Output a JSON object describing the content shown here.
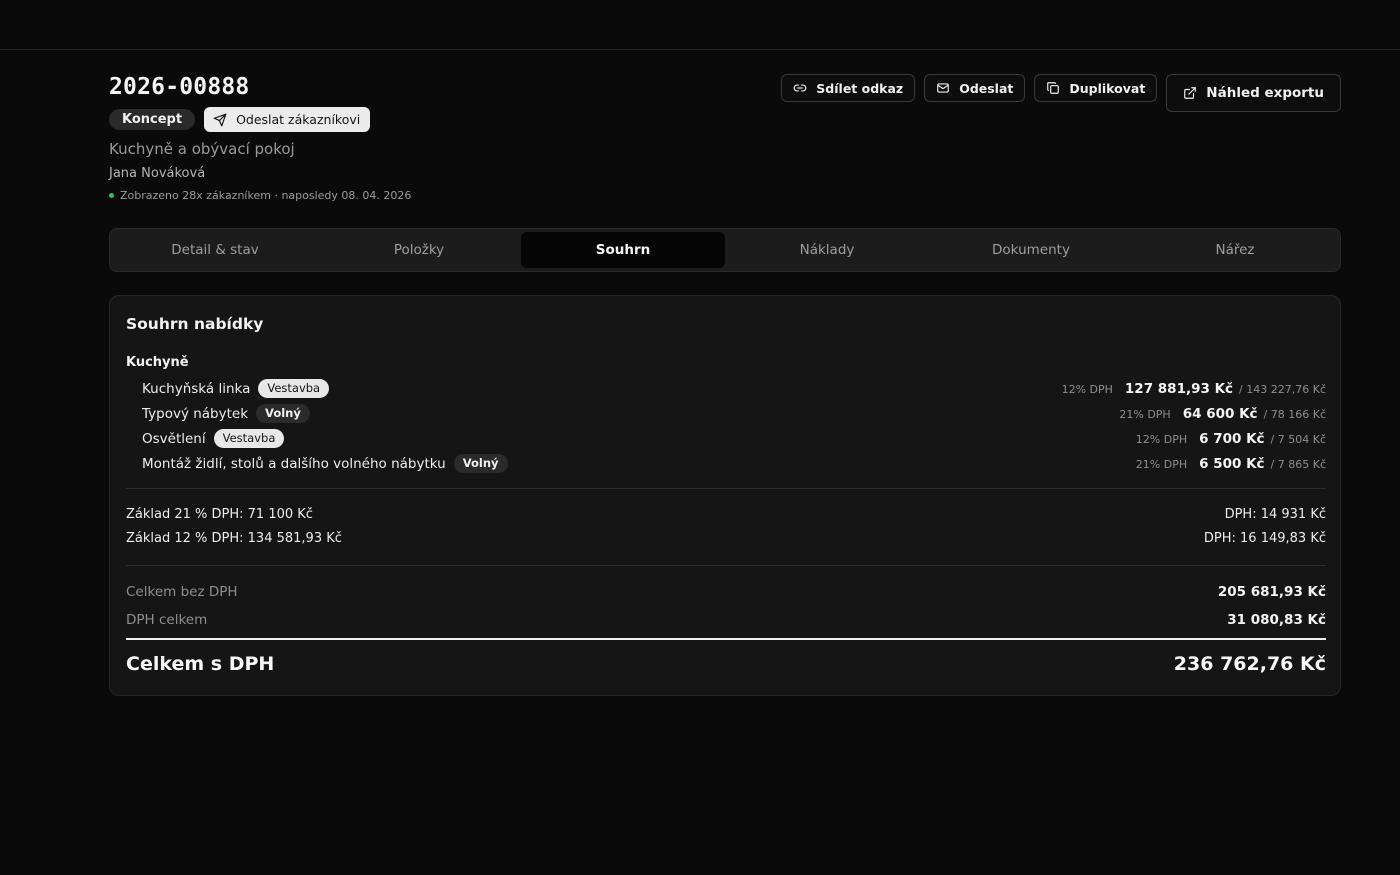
{
  "header": {
    "doc_id": "2026-00888",
    "status": "Koncept",
    "send_to_customer_label": "Odeslat zákazníkovi",
    "subtitle": "Kuchyně a obývací pokoj",
    "customer": "Jana Nováková",
    "viewed": "Zobrazeno 28x zákazníkem · naposledy 08. 04. 2026"
  },
  "actions": {
    "share_label": "Sdílet odkaz",
    "send_label": "Odeslat",
    "duplicate_label": "Duplikovat",
    "preview_label": "Náhled exportu"
  },
  "tabs": [
    {
      "label": "Detail & stav",
      "active": false
    },
    {
      "label": "Položky",
      "active": false
    },
    {
      "label": "Souhrn",
      "active": true
    },
    {
      "label": "Náklady",
      "active": false
    },
    {
      "label": "Dokumenty",
      "active": false
    },
    {
      "label": "Nářez",
      "active": false
    }
  ],
  "summary": {
    "title": "Souhrn nabídky",
    "group": "Kuchyně",
    "items": [
      {
        "name": "Kuchyňská linka",
        "tag": "Vestavba",
        "tag_style": "light",
        "vat": "12% DPH",
        "net": "127 881,93 Kč",
        "gross": "/ 143 227,76 Kč"
      },
      {
        "name": "Typový nábytek",
        "tag": "Volný",
        "tag_style": "dark",
        "vat": "21% DPH",
        "net": "64 600 Kč",
        "gross": "/ 78 166 Kč"
      },
      {
        "name": "Osvětlení",
        "tag": "Vestavba",
        "tag_style": "light",
        "vat": "12% DPH",
        "net": "6 700 Kč",
        "gross": "/ 7 504 Kč"
      },
      {
        "name": "Montáž židlí, stolů a dalšího volného nábytku",
        "tag": "Volný",
        "tag_style": "dark",
        "vat": "21% DPH",
        "net": "6 500 Kč",
        "gross": "/ 7 865 Kč"
      }
    ],
    "base21_label": "Základ 21 % DPH: 71 100 Kč",
    "vat21_label": "DPH: 14 931 Kč",
    "base12_label": "Základ 12 % DPH: 134 581,93 Kč",
    "vat12_label": "DPH: 16 149,83 Kč",
    "total_net_label": "Celkem bez DPH",
    "total_net_value": "205 681,93 Kč",
    "vat_total_label": "DPH celkem",
    "vat_total_value": "31 080,83 Kč",
    "grand_total_label": "Celkem s DPH",
    "grand_total_value": "236 762,76 Kč"
  },
  "colors": {
    "background": "#0a0a0a",
    "card": "#151515",
    "viewed_dot": "#22c55e"
  }
}
